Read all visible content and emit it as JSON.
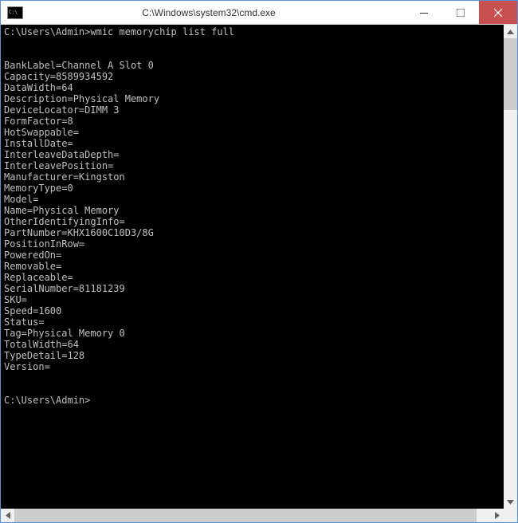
{
  "window": {
    "title": "C:\\Windows\\system32\\cmd.exe"
  },
  "console": {
    "prompt1": "C:\\Users\\Admin>",
    "command": "wmic memorychip list full",
    "blank": "",
    "lines": {
      "l01": "BankLabel=Channel A Slot 0",
      "l02": "Capacity=8589934592",
      "l03": "DataWidth=64",
      "l04": "Description=Physical Memory",
      "l05": "DeviceLocator=DIMM 3",
      "l06": "FormFactor=8",
      "l07": "HotSwappable=",
      "l08": "InstallDate=",
      "l09": "InterleaveDataDepth=",
      "l10": "InterleavePosition=",
      "l11": "Manufacturer=Kingston",
      "l12": "MemoryType=0",
      "l13": "Model=",
      "l14": "Name=Physical Memory",
      "l15": "OtherIdentifyingInfo=",
      "l16": "PartNumber=KHX1600C10D3/8G",
      "l17": "PositionInRow=",
      "l18": "PoweredOn=",
      "l19": "Removable=",
      "l20": "Replaceable=",
      "l21": "SerialNumber=81181239",
      "l22": "SKU=",
      "l23": "Speed=1600",
      "l24": "Status=",
      "l25": "Tag=Physical Memory 0",
      "l26": "TotalWidth=64",
      "l27": "TypeDetail=128",
      "l28": "Version="
    },
    "prompt2": "C:\\Users\\Admin>"
  }
}
